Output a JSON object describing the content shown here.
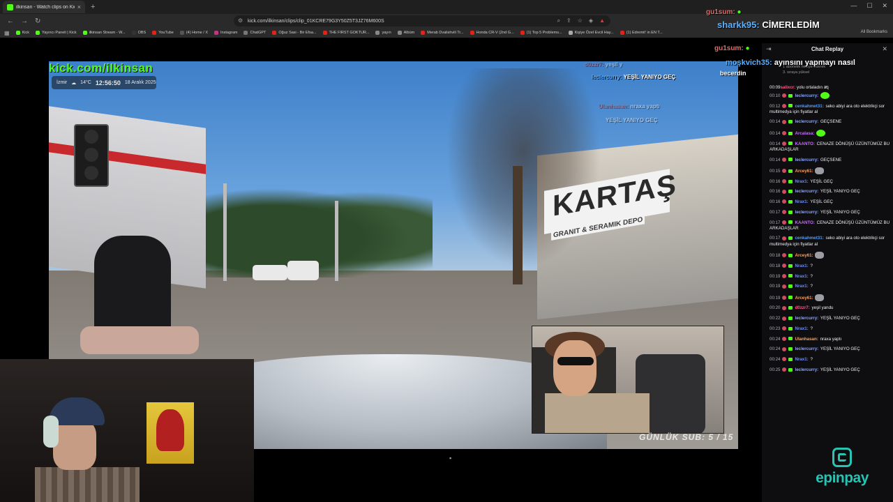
{
  "browser": {
    "tab": {
      "title": "ilkinsan - Watch clips on Kick",
      "close": "×"
    },
    "new_tab": "+",
    "url": "kick.com/ilkinsan/clips/clip_01KCRE79G3Y50Z5T3JZ76M600S",
    "bookmarks": [
      {
        "label": "Kick",
        "color": "#53fc18"
      },
      {
        "label": "Yayıncı Paneli | Kick",
        "color": "#53fc18"
      },
      {
        "label": "ilkinsan Stream - W...",
        "color": "#53fc18"
      },
      {
        "label": "OBS",
        "color": "#333333"
      },
      {
        "label": "YouTube",
        "color": "#e62117"
      },
      {
        "label": "(4) Home / X",
        "color": "#555555"
      },
      {
        "label": "Instagram",
        "color": "#c13584"
      },
      {
        "label": "ChatGPT",
        "color": "#777777"
      },
      {
        "label": "Oğuz Sasi - Bir Efsa...",
        "color": "#e62117"
      },
      {
        "label": "THE FIRST GOKTUR...",
        "color": "#e62117"
      },
      {
        "label": "yayın",
        "color": "#888888"
      },
      {
        "label": "Albüm",
        "color": "#888888"
      },
      {
        "label": "Merab Dvalishvili Tr...",
        "color": "#e62117"
      },
      {
        "label": "Honda CR-V (2nd G...",
        "color": "#e62117"
      },
      {
        "label": "(1) Top 5 Problems...",
        "color": "#e62117"
      },
      {
        "label": "Kişiye Özel Evcil Hay...",
        "color": "#aaaaaa"
      },
      {
        "label": "(1) Edremit' in EN T...",
        "color": "#e62117"
      }
    ],
    "all_bookmarks": "All Bookmarks"
  },
  "video": {
    "watermark": "kick.com/ilkinsan",
    "location": "İzmir",
    "temperature": "14°C",
    "time": "12:56:50",
    "date": "18 Aralık 2025",
    "daily_sub": "GÜNLÜK SUB: 5 / 15",
    "sign_text": "KARTAŞ",
    "sign_sub": "GRANIT & SERAMIK DEPO"
  },
  "overlay_chat": {
    "line1_user": "gu1sum:",
    "line2_user": "sharkk95:",
    "line2_msg": "CİMERLEDİM",
    "line3_user": "gu1sum:",
    "line4_user": "moşkvich35:",
    "line4_msg": "ayınsını yapmayı nasıl",
    "line5_msg": "becerdin"
  },
  "overlay_mid": {
    "r1_user": "d0zzr7:",
    "r1_msg": "yeşil y",
    "r2_user": "leclercurry:",
    "r2_msg": "YEŞİL YANIYO GEÇ",
    "r3_user": "Ulanhasan:",
    "r3_msg": "nraxa yaptı",
    "r4_msg": "YEŞİL YANIYO GEÇ"
  },
  "chat": {
    "title": "Chat Replay",
    "pinned_user": "salixcr:",
    "pinned_msg": "yolu ortaladın aq",
    "pinned_note1": "1 abonelik hediye ederek",
    "pinned_note2": "3. sıraya yüksel",
    "messages": [
      {
        "time": "00:10",
        "user": "leclercurry:",
        "color": "#8aa6ff",
        "msg": "",
        "emote": "green"
      },
      {
        "time": "00:12",
        "user": "cenkahmet31:",
        "color": "#4f9cff",
        "msg": "seko abiyi ara oto elektrikçi sor multimedya için fiyatlar al",
        "emote": ""
      },
      {
        "time": "00:14",
        "user": "leclercurry:",
        "color": "#8aa6ff",
        "msg": "GEÇSENE",
        "emote": ""
      },
      {
        "time": "00:14",
        "user": "Arcalasa:",
        "color": "#c86bff",
        "msg": "",
        "emote": "green"
      },
      {
        "time": "00:14",
        "user": "KAANTO:",
        "color": "#c86bff",
        "msg": "CENAZE DÖNÜŞÜ ÜZÜNTÜMÜZ BU ARKADAŞLAR",
        "emote": ""
      },
      {
        "time": "00:14",
        "user": "leclercurry:",
        "color": "#8aa6ff",
        "msg": "GEÇSENE",
        "emote": ""
      },
      {
        "time": "00:15",
        "user": "Arcey61:",
        "color": "#ff9f5a",
        "msg": "",
        "emote": "rat"
      },
      {
        "time": "00:16",
        "user": "Nrax1:",
        "color": "#6b8cff",
        "msg": "YEŞİL GEÇ",
        "emote": ""
      },
      {
        "time": "00:16",
        "user": "leclercurry:",
        "color": "#8aa6ff",
        "msg": "YEŞİL YANIYO GEÇ",
        "emote": ""
      },
      {
        "time": "00:16",
        "user": "Nrax1:",
        "color": "#6b8cff",
        "msg": "YEŞİL GEÇ",
        "emote": ""
      },
      {
        "time": "00:17",
        "user": "leclercurry:",
        "color": "#8aa6ff",
        "msg": "YEŞİL YANIYO GEÇ",
        "emote": ""
      },
      {
        "time": "00:17",
        "user": "KAANTO:",
        "color": "#c86bff",
        "msg": "CENAZE DÖNÜŞÜ ÜZÜNTÜMÜZ BU ARKADAŞLAR",
        "emote": ""
      },
      {
        "time": "00:17",
        "user": "cenkahmet31:",
        "color": "#4f9cff",
        "msg": "seko abiyi ara oto elektrikçi sor multimedya için fiyatlar al",
        "emote": ""
      },
      {
        "time": "00:18",
        "user": "Arcey61:",
        "color": "#ff9f5a",
        "msg": "",
        "emote": "rat"
      },
      {
        "time": "00:18",
        "user": "Nrax1:",
        "color": "#6b8cff",
        "msg": "?",
        "emote": ""
      },
      {
        "time": "00:19",
        "user": "Nrax1:",
        "color": "#6b8cff",
        "msg": "?",
        "emote": ""
      },
      {
        "time": "00:19",
        "user": "Nrax1:",
        "color": "#6b8cff",
        "msg": "?",
        "emote": ""
      },
      {
        "time": "00:19",
        "user": "Arcey61:",
        "color": "#ff9f5a",
        "msg": "",
        "emote": "rat"
      },
      {
        "time": "00:20",
        "user": "d0zzr7:",
        "color": "#ff5a8a",
        "msg": "yeşil yandu",
        "emote": ""
      },
      {
        "time": "00:22",
        "user": "leclercurry:",
        "color": "#8aa6ff",
        "msg": "YEŞİL YANIYO GEÇ",
        "emote": ""
      },
      {
        "time": "00:23",
        "user": "Nrax1:",
        "color": "#6b8cff",
        "msg": "?",
        "emote": ""
      },
      {
        "time": "00:24",
        "user": "Ulanhasan:",
        "color": "#ff9f5a",
        "msg": "nraxa yaptı",
        "emote": ""
      },
      {
        "time": "00:24",
        "user": "leclercurry:",
        "color": "#8aa6ff",
        "msg": "YEŞİL YANIYO GEÇ",
        "emote": ""
      },
      {
        "time": "00:24",
        "user": "Nrax1:",
        "color": "#6b8cff",
        "msg": "?",
        "emote": ""
      },
      {
        "time": "00:25",
        "user": "leclercurry:",
        "color": "#8aa6ff",
        "msg": "YEŞİL YANIYO GEÇ",
        "emote": ""
      }
    ]
  },
  "sponsor": {
    "name": "epinpay",
    "color": "#27c3b3"
  }
}
